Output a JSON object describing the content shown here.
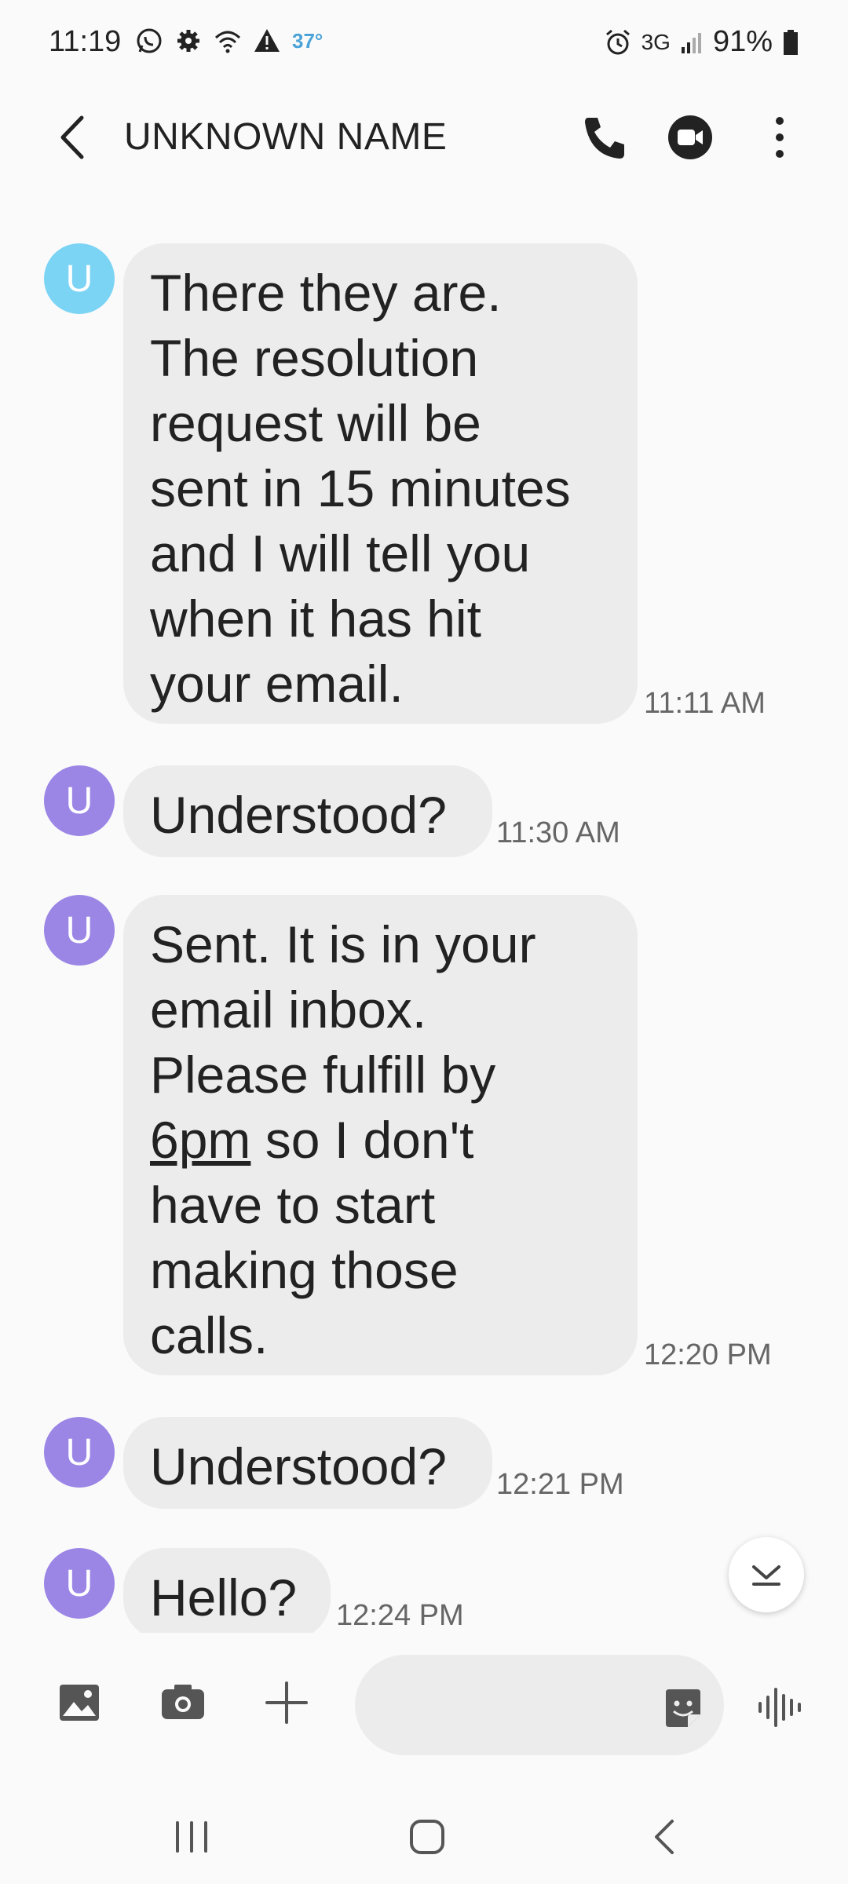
{
  "status_bar": {
    "time": "11:19",
    "temperature": "37°",
    "network": "3G",
    "battery": "91%"
  },
  "header": {
    "title": "UNKNOWN NAME"
  },
  "messages": [
    {
      "avatar": "U",
      "text_lines": [
        "There they are.",
        "The resolution",
        "request will be",
        "sent in 15 minutes",
        "and I will tell you",
        "when it has hit",
        "your email."
      ],
      "time": "11:11 AM"
    },
    {
      "avatar": "U",
      "text_lines": [
        "Understood?"
      ],
      "time": "11:30 AM"
    },
    {
      "avatar": "U",
      "text_lines": [
        "Sent. It is in your",
        "email inbox.",
        "Please fulfill by",
        "6pm",
        "so I don't",
        "have to start",
        "making those",
        "calls."
      ],
      "time": "12:20 PM"
    },
    {
      "avatar": "U",
      "text_lines": [
        "Understood?"
      ],
      "time": "12:21 PM"
    },
    {
      "avatar": "U",
      "text_lines": [
        "Hello?"
      ],
      "time": "12:24 PM"
    }
  ],
  "composer": {
    "placeholder": ""
  },
  "colors": {
    "avatar_blue": "#7cd4f5",
    "avatar_purple": "#9b86e6",
    "bubble": "#ececec",
    "background": "#fafafa"
  },
  "icons": [
    "whatsapp-icon",
    "settings-icon",
    "wifi-icon",
    "warning-icon",
    "alarm-icon",
    "signal-icon",
    "battery-icon",
    "back-arrow-icon",
    "phone-icon",
    "video-icon",
    "more-icon",
    "gallery-icon",
    "camera-icon",
    "plus-icon",
    "sticker-icon",
    "voice-icon",
    "scroll-down-icon",
    "recent-apps-icon",
    "home-icon",
    "nav-back-icon"
  ]
}
